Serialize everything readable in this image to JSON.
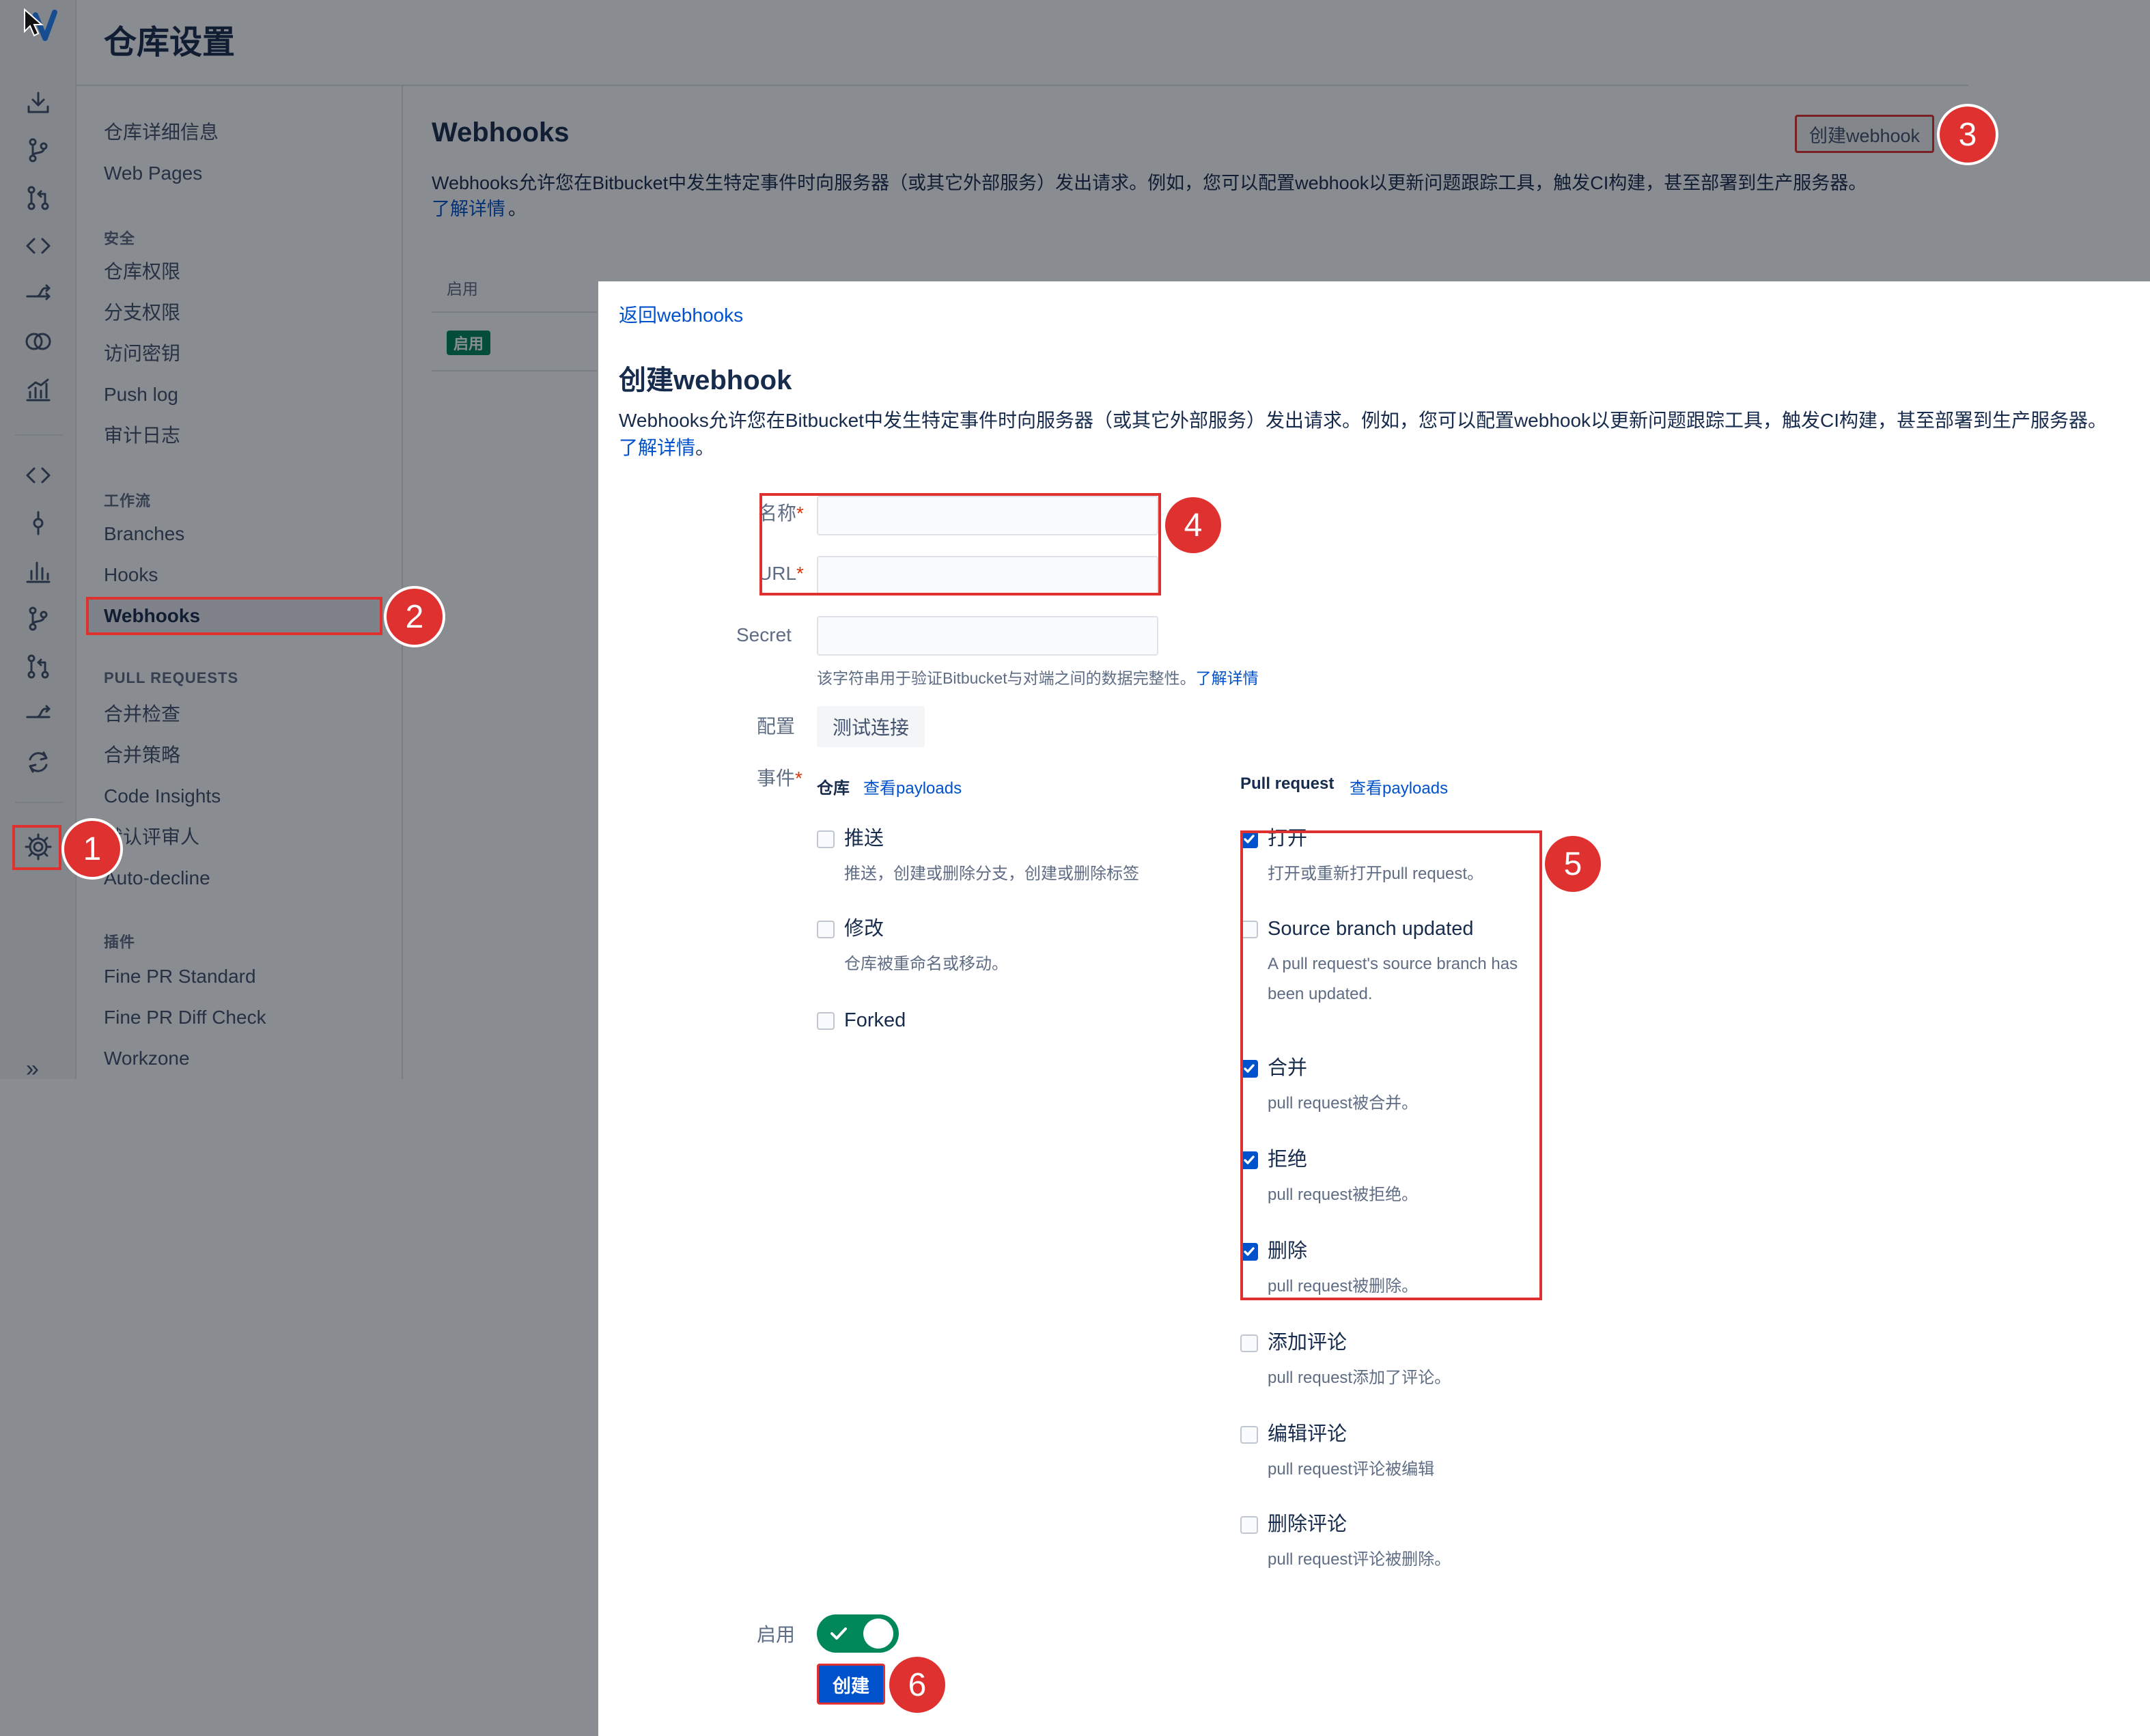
{
  "page": {
    "title": "仓库设置"
  },
  "rail": {
    "icons": [
      "download-icon",
      "branch-icon",
      "pull-request-icon",
      "compare-icon",
      "fork-icon",
      "venn-icon",
      "chart-icon",
      "code-icon",
      "commit-icon",
      "bar-chart-icon",
      "branch-icon",
      "pull-request-icon",
      "compare-icon",
      "sync-icon",
      "gear-icon"
    ],
    "expand_label": "»"
  },
  "settings_nav": {
    "items_top": [
      "仓库详细信息",
      "Web Pages"
    ],
    "security_head": "安全",
    "security_items": [
      "仓库权限",
      "分支权限",
      "访问密钥",
      "Push log",
      "审计日志"
    ],
    "workflow_head": "工作流",
    "workflow_items": [
      "Branches",
      "Hooks",
      "Webhooks"
    ],
    "pr_head": "PULL REQUESTS",
    "pr_items": [
      "合并检查",
      "合并策略",
      "Code Insights",
      "默认评审人",
      "Auto-decline"
    ],
    "plugins_head": "插件",
    "plugins_items": [
      "Fine PR Standard",
      "Fine PR Diff Check",
      "Workzone"
    ]
  },
  "webhooks_page": {
    "title": "Webhooks",
    "description": "Webhooks允许您在Bitbucket中发生特定事件时向服务器（或其它外部服务）发出请求。例如，您可以配置webhook以更新问题跟踪工具，触发CI构建，甚至部署到生产服务器。",
    "learn_more": "了解详情",
    "learn_more_tail": "。",
    "create_button": "创建webhook",
    "table_header_enabled": "启用",
    "row_status": "启用"
  },
  "modal": {
    "back_link": "返回webhooks",
    "title": "创建webhook",
    "description": "Webhooks允许您在Bitbucket中发生特定事件时向服务器（或其它外部服务）发出请求。例如，您可以配置webhook以更新问题跟踪工具，触发CI构建，甚至部署到生产服务器。",
    "learn_more": "了解详情",
    "learn_more_tail": "。",
    "name_label": "名称",
    "url_label": "URL",
    "required_mark": "*",
    "name_value": "",
    "url_value": "",
    "secret_label": "Secret",
    "secret_value": "",
    "secret_help": "该字符串用于验证Bitbucket与对端之间的数据完整性。",
    "secret_help_link": "了解详情",
    "config_label": "配置",
    "test_button": "测试连接",
    "events_label": "事件",
    "repo_group": {
      "title": "仓库",
      "payloads_link": "查看payloads",
      "events": [
        {
          "label": "推送",
          "desc": "推送，创建或删除分支，创建或删除标签",
          "checked": false
        },
        {
          "label": "修改",
          "desc": "仓库被重命名或移动。",
          "checked": false
        },
        {
          "label": "Forked",
          "desc": "",
          "checked": false
        }
      ]
    },
    "pr_group": {
      "title": "Pull request",
      "payloads_link": "查看payloads",
      "events": [
        {
          "label": "打开",
          "desc": "打开或重新打开pull request。",
          "checked": true
        },
        {
          "label": "Source branch updated",
          "desc": "A pull request's source branch has been updated.",
          "checked": false
        },
        {
          "label": "合并",
          "desc": "pull request被合并。",
          "checked": true
        },
        {
          "label": "拒绝",
          "desc": "pull request被拒绝。",
          "checked": true
        },
        {
          "label": "删除",
          "desc": "pull request被删除。",
          "checked": true
        },
        {
          "label": "添加评论",
          "desc": "pull request添加了评论。",
          "checked": false
        },
        {
          "label": "编辑评论",
          "desc": "pull request评论被编辑",
          "checked": false
        },
        {
          "label": "删除评论",
          "desc": "pull request评论被删除。",
          "checked": false
        }
      ]
    },
    "enable_label": "启用",
    "enabled": true,
    "create_button": "创建"
  },
  "annotations": [
    "1",
    "2",
    "3",
    "4",
    "5",
    "6"
  ],
  "colors": {
    "primary": "#0052cc",
    "success": "#00875a",
    "annotation": "#e03131",
    "text": "#172b4d",
    "subtle_text": "#5e6c84"
  }
}
